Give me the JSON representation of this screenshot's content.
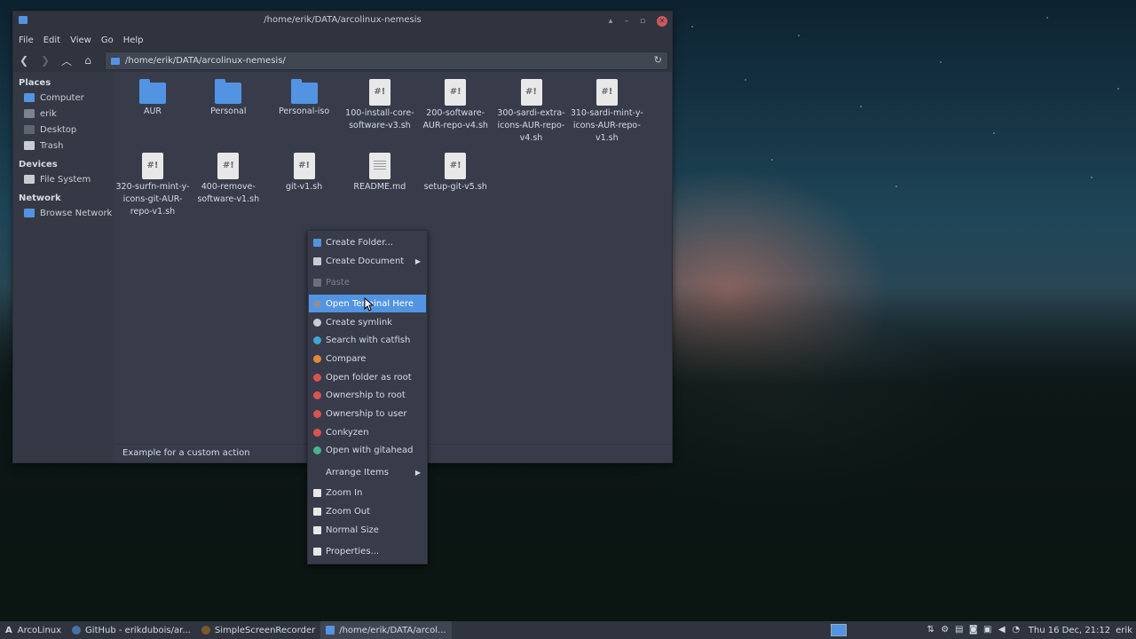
{
  "window": {
    "title": "/home/erik/DATA/arcolinux-nemesis",
    "menu": [
      "File",
      "Edit",
      "View",
      "Go",
      "Help"
    ],
    "location": "/home/erik/DATA/arcolinux-nemesis/",
    "status": "Example for a custom action"
  },
  "sidebar": {
    "places_label": "Places",
    "places": [
      {
        "label": "Computer",
        "icon": "computer-icon",
        "color": "#5294e2"
      },
      {
        "label": "erik",
        "icon": "home-icon",
        "color": "#7c8290"
      },
      {
        "label": "Desktop",
        "icon": "desktop-folder-icon",
        "color": "#5f6570"
      },
      {
        "label": "Trash",
        "icon": "trash-icon",
        "color": "#c8cdd3"
      }
    ],
    "devices_label": "Devices",
    "devices": [
      {
        "label": "File System",
        "icon": "drive-icon",
        "color": "#c8cdd3"
      }
    ],
    "network_label": "Network",
    "network": [
      {
        "label": "Browse Network",
        "icon": "network-icon",
        "color": "#5294e2"
      }
    ]
  },
  "files": [
    {
      "name": "AUR",
      "kind": "folder"
    },
    {
      "name": "Personal",
      "kind": "folder"
    },
    {
      "name": "Personal-iso",
      "kind": "folder"
    },
    {
      "name": "100-install-core-software-v3.sh",
      "kind": "script"
    },
    {
      "name": "200-software-AUR-repo-v4.sh",
      "kind": "script"
    },
    {
      "name": "300-sardi-extra-icons-AUR-repo-v4.sh",
      "kind": "script"
    },
    {
      "name": "310-sardi-mint-y-icons-AUR-repo-v1.sh",
      "kind": "script"
    },
    {
      "name": "320-surfn-mint-y-icons-git-AUR-repo-v1.sh",
      "kind": "script"
    },
    {
      "name": "400-remove-software-v1.sh",
      "kind": "script"
    },
    {
      "name": "git-v1.sh",
      "kind": "script"
    },
    {
      "name": "README.md",
      "kind": "doc"
    },
    {
      "name": "setup-git-v5.sh",
      "kind": "script"
    }
  ],
  "script_glyph": "#!",
  "context_menu": [
    {
      "label": "Create Folder...",
      "icon": "folder-icon",
      "color": "#5294e2"
    },
    {
      "label": "Create Document",
      "icon": "document-icon",
      "color": "#c8cdd3",
      "submenu": true
    },
    {
      "label": "Paste",
      "icon": "paste-icon",
      "color": "#6a6f79",
      "disabled": true
    },
    {
      "label": "Open Terminal Here",
      "icon": "terminal-icon",
      "color": "#8a8f99",
      "highlighted": true
    },
    {
      "label": "Create symlink",
      "icon": "link-icon",
      "color": "#c8cdd3"
    },
    {
      "label": "Search with catfish",
      "icon": "catfish-icon",
      "color": "#3fa7d6"
    },
    {
      "label": "Compare",
      "icon": "compare-icon",
      "color": "#e08a3a"
    },
    {
      "label": "Open folder as root",
      "icon": "root-icon",
      "color": "#d9534f"
    },
    {
      "label": "Ownership to root",
      "icon": "ownership-root-icon",
      "color": "#d9534f"
    },
    {
      "label": "Ownership to user",
      "icon": "ownership-user-icon",
      "color": "#d9534f"
    },
    {
      "label": "Conkyzen",
      "icon": "conkyzen-icon",
      "color": "#d9534f"
    },
    {
      "label": "Open with gitahead",
      "icon": "gitahead-icon",
      "color": "#49b38f"
    },
    {
      "label": "Arrange Items",
      "icon": "none",
      "color": "transparent",
      "submenu": true
    },
    {
      "label": "Zoom In",
      "icon": "zoom-in-icon",
      "color": "#e8e8e8"
    },
    {
      "label": "Zoom Out",
      "icon": "zoom-out-icon",
      "color": "#e8e8e8"
    },
    {
      "label": "Normal Size",
      "icon": "normal-size-icon",
      "color": "#e8e8e8"
    },
    {
      "label": "Properties...",
      "icon": "properties-icon",
      "color": "#e8e8e8"
    }
  ],
  "taskbar": {
    "start": "ArcoLinux",
    "items": [
      {
        "label": "GitHub - erikdubois/ar...",
        "icon": "browser-icon",
        "color": "#4a6fa5"
      },
      {
        "label": "SimpleScreenRecorder",
        "icon": "recorder-icon",
        "color": "#7a5a2a"
      },
      {
        "label": "/home/erik/DATA/arcol...",
        "icon": "folder-icon",
        "color": "#5294e2",
        "active": true
      }
    ],
    "clock": "Thu 16 Dec, 21:12",
    "user": "erik"
  }
}
